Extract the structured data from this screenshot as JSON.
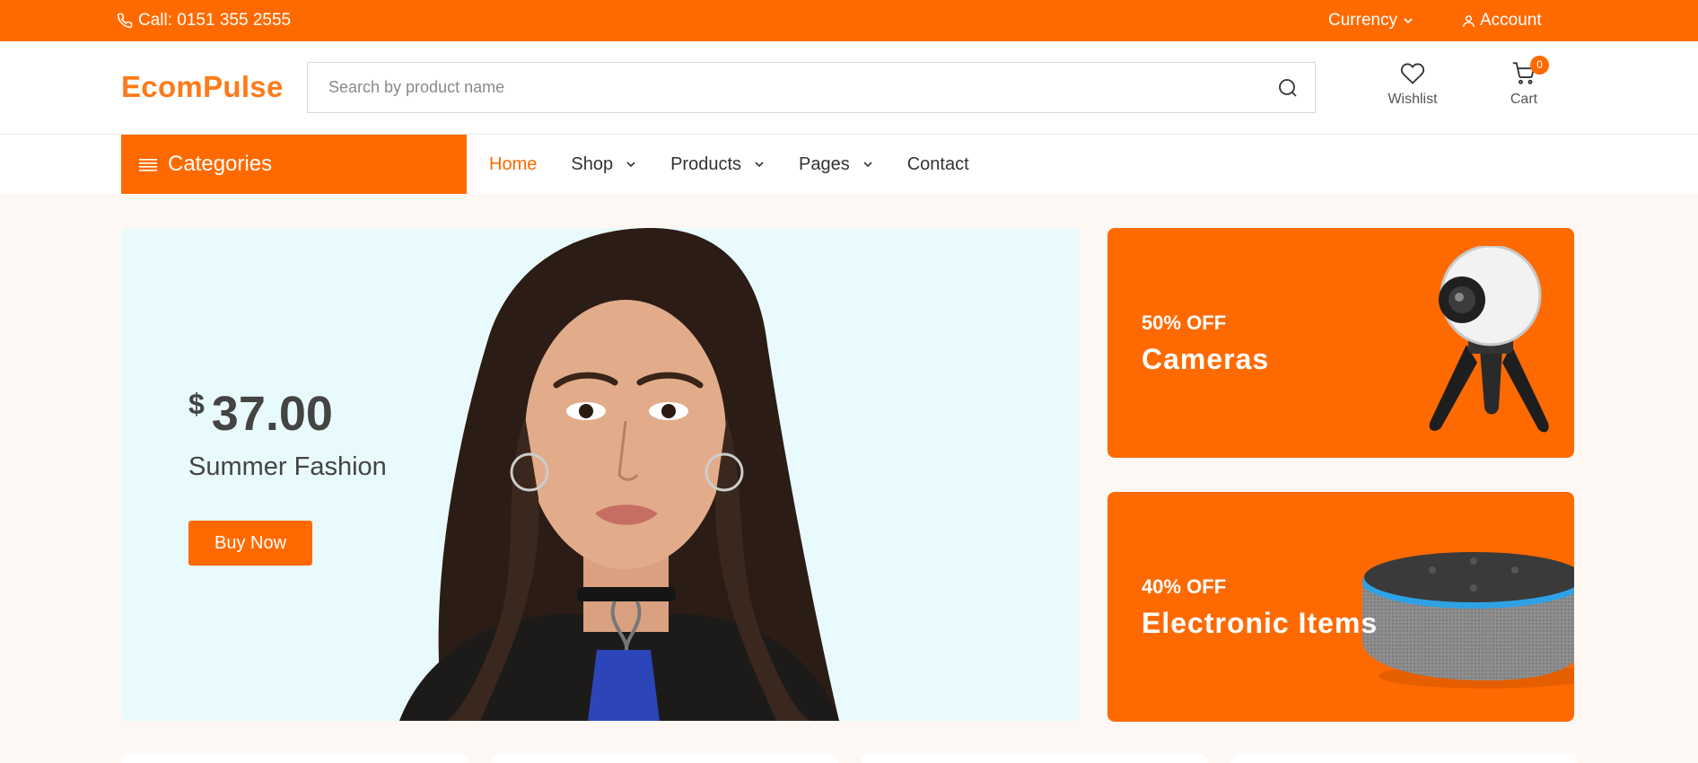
{
  "topbar": {
    "call_text": "Call: 0151 355 2555",
    "currency_label": "Currency",
    "account_label": "Account"
  },
  "header": {
    "logo": "EcomPulse",
    "search_placeholder": "Search by product name",
    "wishlist_label": "Wishlist",
    "cart_label": "Cart",
    "cart_count": "0"
  },
  "nav": {
    "categories_label": "Categories",
    "links": [
      {
        "label": "Home",
        "active": true,
        "dropdown": false
      },
      {
        "label": "Shop",
        "active": false,
        "dropdown": true
      },
      {
        "label": "Products",
        "active": false,
        "dropdown": true
      },
      {
        "label": "Pages",
        "active": false,
        "dropdown": true
      },
      {
        "label": "Contact",
        "active": false,
        "dropdown": false
      }
    ]
  },
  "hero": {
    "currency": "$",
    "price": "37.00",
    "subtitle": "Summer Fashion",
    "button": "Buy Now"
  },
  "promos": [
    {
      "discount": "50% OFF",
      "title": "Cameras",
      "image_icon": "camera-360-icon"
    },
    {
      "discount": "40% OFF",
      "title": "Electronic Items",
      "image_icon": "smart-speaker-icon"
    }
  ],
  "colors": {
    "accent": "#ff6a00",
    "logo": "#ff7a1a",
    "hero_bg": "#e8fafb",
    "page_bg": "#fdf8f3"
  }
}
